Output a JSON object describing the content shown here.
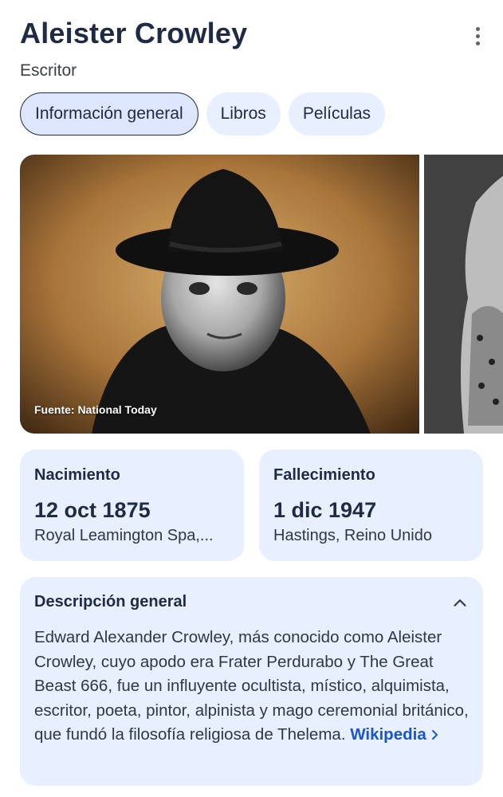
{
  "header": {
    "title": "Aleister Crowley",
    "subtitle": "Escritor",
    "menu_icon": "more-vertical-icon"
  },
  "tabs": [
    {
      "label": "Información general",
      "active": true
    },
    {
      "label": "Libros",
      "active": false
    },
    {
      "label": "Películas",
      "active": false
    }
  ],
  "images": {
    "caption": "Fuente: National Today"
  },
  "facts": {
    "birth": {
      "label": "Nacimiento",
      "date": "12 oct 1875",
      "place": "Royal Leamington Spa,..."
    },
    "death": {
      "label": "Fallecimiento",
      "date": "1 dic 1947",
      "place": "Hastings, Reino Unido"
    }
  },
  "overview": {
    "label": "Descripción general",
    "text": "Edward Alexander Crowley, más conocido como Aleister Crowley, cuyo apodo era Frater Perdurabo y The Great Beast 666,  fue un influyente ocultista, místico, alquimista, escritor, poeta, pintor, alpinista y mago ceremonial británico, que fundó la filosofía religiosa de Thelema.",
    "source_link": "Wikipedia",
    "collapse_icon": "chevron-up-icon"
  },
  "colors": {
    "card_bg": "#e8efff",
    "title": "#1f2a44",
    "link": "#1a57c9"
  }
}
